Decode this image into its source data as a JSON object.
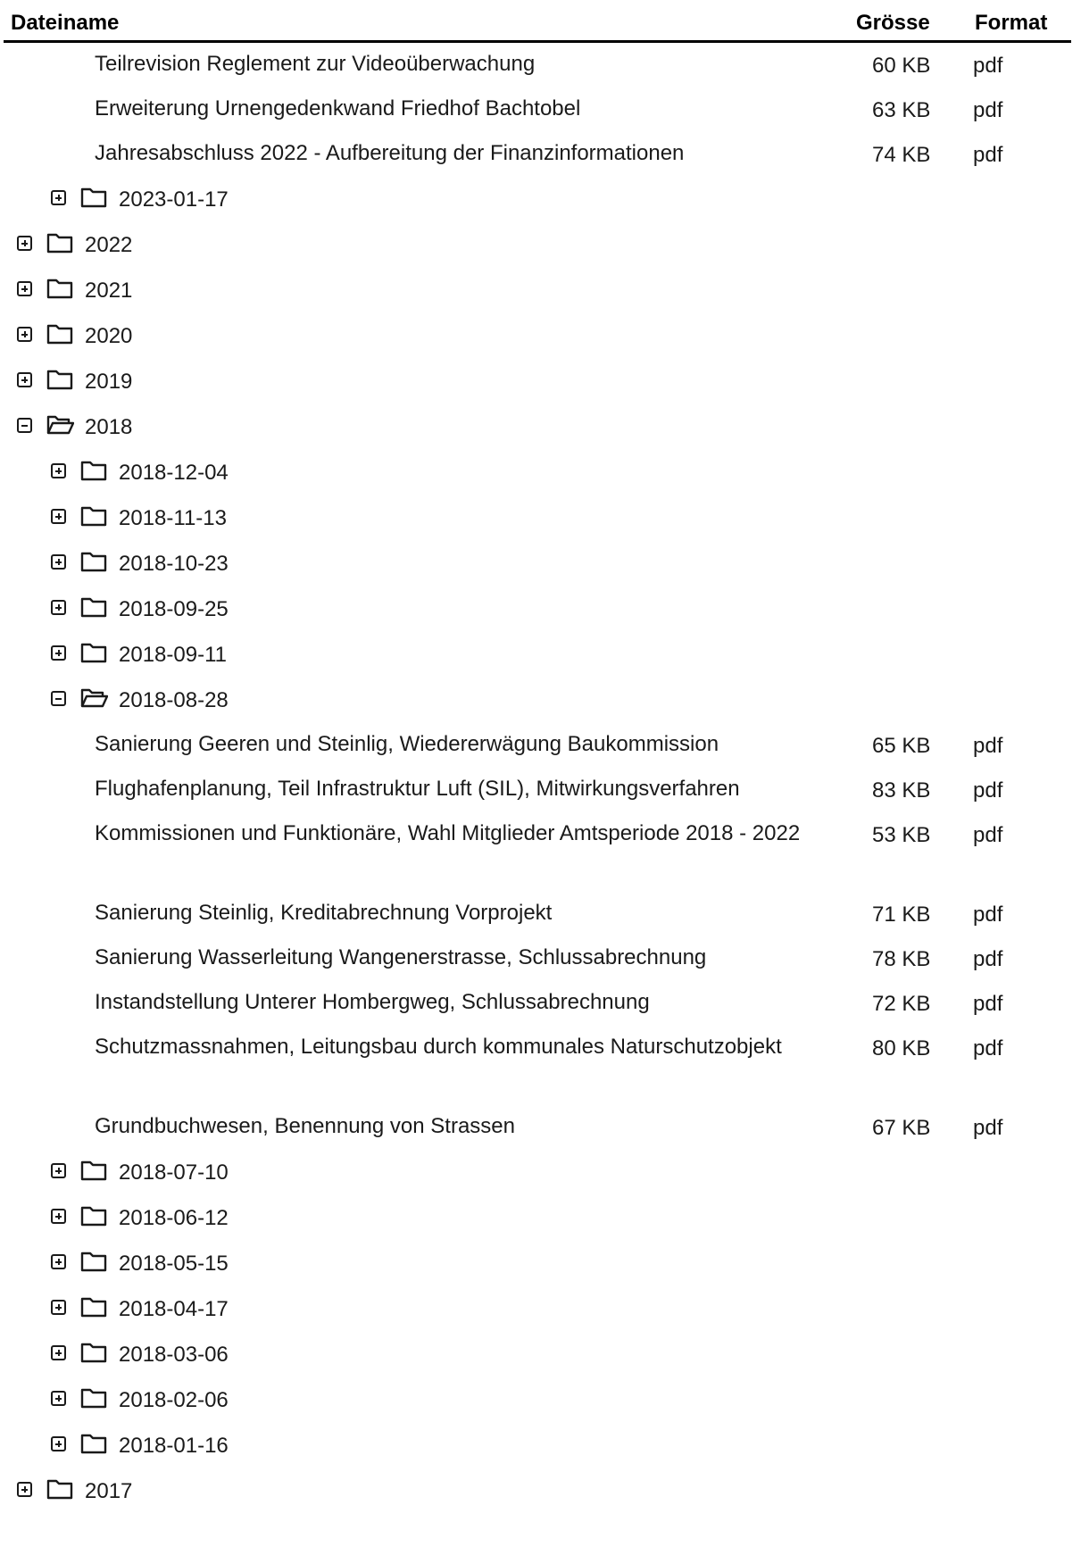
{
  "columns": {
    "name": "Dateiname",
    "size": "Grösse",
    "format": "Format"
  },
  "icons": {
    "expand": "plus-square-icon",
    "collapse": "minus-square-icon",
    "closed_folder": "folder-icon",
    "open_folder": "folder-open-icon"
  },
  "rows": [
    {
      "kind": "file",
      "name": "Teilrevision Reglement zur Videoüberwachung",
      "size": "60 KB",
      "format": "pdf"
    },
    {
      "kind": "file",
      "name": "Erweiterung Urnengedenkwand Friedhof Bachtobel",
      "size": "63 KB",
      "format": "pdf"
    },
    {
      "kind": "file",
      "name": "Jahresabschluss 2022 - Aufbereitung der Finanzinformationen",
      "size": "74 KB",
      "format": "pdf"
    },
    {
      "kind": "folder",
      "level": 2,
      "expanded": false,
      "label": "2023-01-17"
    },
    {
      "kind": "folder",
      "level": 1,
      "expanded": false,
      "label": "2022"
    },
    {
      "kind": "folder",
      "level": 1,
      "expanded": false,
      "label": "2021"
    },
    {
      "kind": "folder",
      "level": 1,
      "expanded": false,
      "label": "2020"
    },
    {
      "kind": "folder",
      "level": 1,
      "expanded": false,
      "label": "2019"
    },
    {
      "kind": "folder",
      "level": 1,
      "expanded": true,
      "label": "2018"
    },
    {
      "kind": "folder",
      "level": 2,
      "expanded": false,
      "label": "2018-12-04"
    },
    {
      "kind": "folder",
      "level": 2,
      "expanded": false,
      "label": "2018-11-13"
    },
    {
      "kind": "folder",
      "level": 2,
      "expanded": false,
      "label": "2018-10-23"
    },
    {
      "kind": "folder",
      "level": 2,
      "expanded": false,
      "label": "2018-09-25"
    },
    {
      "kind": "folder",
      "level": 2,
      "expanded": false,
      "label": "2018-09-11"
    },
    {
      "kind": "folder",
      "level": 2,
      "expanded": true,
      "label": "2018-08-28"
    },
    {
      "kind": "file",
      "name": "Sanierung Geeren und Steinlig, Wiedererwägung Baukommission",
      "size": "65 KB",
      "format": "pdf"
    },
    {
      "kind": "file",
      "name": "Flughafenplanung, Teil Infrastruktur Luft (SIL), Mitwirkungsverfahren",
      "size": "83 KB",
      "format": "pdf"
    },
    {
      "kind": "file",
      "name": "Kommissionen und Funktionäre, Wahl Mitglieder Amtsperiode 2018 - 2022",
      "size": "53 KB",
      "format": "pdf",
      "wrap": true
    },
    {
      "kind": "file",
      "name": "Sanierung Steinlig, Kreditabrechnung Vorprojekt",
      "size": "71 KB",
      "format": "pdf"
    },
    {
      "kind": "file",
      "name": "Sanierung Wasserleitung Wangenerstrasse, Schlussabrechnung",
      "size": "78 KB",
      "format": "pdf"
    },
    {
      "kind": "file",
      "name": "Instandstellung Unterer Hombergweg, Schlussabrechnung",
      "size": "72 KB",
      "format": "pdf"
    },
    {
      "kind": "file",
      "name": "Schutzmassnahmen, Leitungsbau durch kommunales Naturschutzobjekt",
      "size": "80 KB",
      "format": "pdf",
      "wrap": true
    },
    {
      "kind": "file",
      "name": "Grundbuchwesen, Benennung von Strassen",
      "size": "67 KB",
      "format": "pdf"
    },
    {
      "kind": "folder",
      "level": 2,
      "expanded": false,
      "label": "2018-07-10"
    },
    {
      "kind": "folder",
      "level": 2,
      "expanded": false,
      "label": "2018-06-12"
    },
    {
      "kind": "folder",
      "level": 2,
      "expanded": false,
      "label": "2018-05-15"
    },
    {
      "kind": "folder",
      "level": 2,
      "expanded": false,
      "label": "2018-04-17"
    },
    {
      "kind": "folder",
      "level": 2,
      "expanded": false,
      "label": "2018-03-06"
    },
    {
      "kind": "folder",
      "level": 2,
      "expanded": false,
      "label": "2018-02-06"
    },
    {
      "kind": "folder",
      "level": 2,
      "expanded": false,
      "label": "2018-01-16"
    },
    {
      "kind": "folder",
      "level": 1,
      "expanded": false,
      "label": "2017"
    }
  ]
}
